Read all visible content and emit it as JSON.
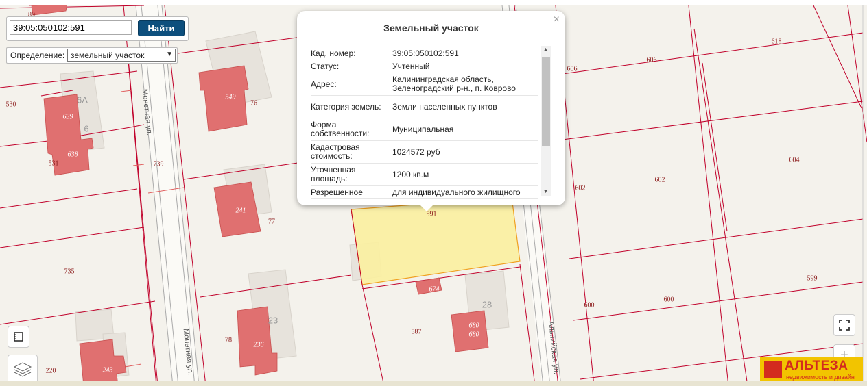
{
  "search": {
    "value": "39:05:050102:591",
    "button_label": "Найти"
  },
  "definition": {
    "label": "Определение:",
    "selected": "земельный участок"
  },
  "popup": {
    "title": "Земельный участок",
    "close": "×",
    "rows": [
      {
        "key": "Кад. номер:",
        "value": "39:05:050102:591"
      },
      {
        "key": "Статус:",
        "value": "Учтенный"
      },
      {
        "key": "Адрес:",
        "value": "Калининградская область, Зеленоградский р-н., п. Коврово"
      },
      {
        "key": "Категория земель:",
        "value": "Земли населенных пунктов"
      },
      {
        "key": "Форма собственности:",
        "value": "Муниципальная"
      },
      {
        "key": "Кадастровая стоимость:",
        "value": "1024572 руб"
      },
      {
        "key": "Уточненная площадь:",
        "value": "1200 кв.м"
      },
      {
        "key": "Разрешенное",
        "value": "для индивидуального жилищного"
      }
    ]
  },
  "map": {
    "parcel_labels": [
      "89",
      "530",
      "531",
      "739",
      "735",
      "220",
      "549",
      "76",
      "241",
      "77",
      "78",
      "236",
      "243",
      "591",
      "674",
      "587",
      "28",
      "680",
      "606",
      "618",
      "602",
      "604",
      "599",
      "600"
    ],
    "building_labels": [
      "639",
      "638",
      "549",
      "241",
      "236",
      "243",
      "674",
      "680",
      "680"
    ],
    "house_numbers": [
      "6А",
      "6",
      "23",
      "28"
    ],
    "streets": [
      "Монетная ул.",
      "Монетная ул.",
      "Альпийская ул."
    ]
  },
  "logo": {
    "name": "АЛЬТЕЗА",
    "tagline": "недвижимость и дизайн"
  },
  "colors": {
    "parcel_line": "#c0002a",
    "building": "#e06a6a",
    "selected_parcel": "#fbefa0",
    "button": "#0d4f7d"
  },
  "icons": [
    "ruler-icon",
    "layers-icon",
    "fullscreen-icon",
    "plus-icon",
    "close-icon"
  ]
}
